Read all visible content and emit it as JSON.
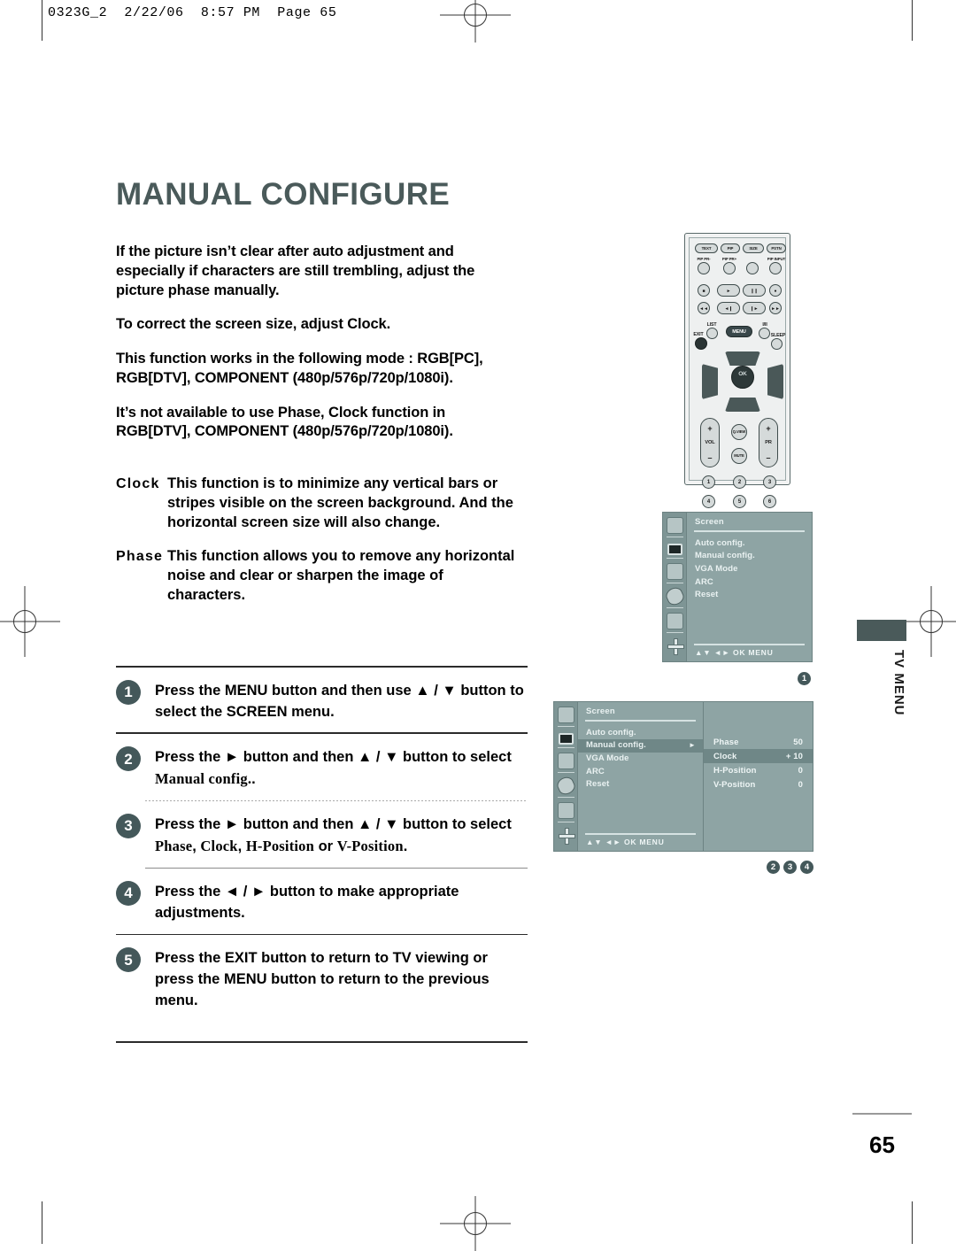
{
  "running_head": "0323G_2  2/22/06  8:57 PM  Page 65",
  "page_title": "MANUAL CONFIGURE",
  "intro_paragraphs": [
    "If the picture isn’t clear after auto adjustment and especially if characters are still trembling, adjust the picture phase manually.",
    "To correct the screen size, adjust Clock.",
    "This function works in the following mode : RGB[PC], RGB[DTV], COMPONENT (480p/576p/720p/1080i).",
    "It’s not available to use Phase, Clock function in RGB[DTV], COMPONENT (480p/576p/720p/1080i)."
  ],
  "para_2_lead": "To correct the screen size, adjust ",
  "para_2_bold": "Clock",
  "para_2_tail": ".",
  "definitions": [
    {
      "term": "Clock",
      "text": "This function is to minimize any vertical bars or stripes visible on the screen background. And the horizontal screen size will also change."
    },
    {
      "term": "Phase",
      "text": "This function allows you to remove any horizontal noise and clear or sharpen the image of characters."
    }
  ],
  "steps": [
    {
      "number": "1",
      "parts": [
        {
          "t": "Press the ",
          "s": "n"
        },
        {
          "t": "MENU",
          "s": "b"
        },
        {
          "t": " button and then use ",
          "s": "n"
        },
        {
          "t": "▲",
          "s": "n"
        },
        {
          "t": " / ",
          "s": "n"
        },
        {
          "t": "▼",
          "s": "n"
        },
        {
          "t": " button to select the ",
          "s": "n"
        },
        {
          "t": "SCREEN",
          "s": "b"
        },
        {
          "t": " menu.",
          "s": "n"
        }
      ],
      "text_plain": "Press the MENU button and then use ▲ / ▼ button to select the SCREEN menu."
    },
    {
      "number": "2",
      "text_plain": "Press the ► button and then ▲ / ▼ button to select Manual config..",
      "lead": "Press the ► button and then ▲ / ▼ button to select ",
      "lg": "Manual config.",
      "tail": "."
    },
    {
      "number": "3",
      "text_plain": "Press the ► button and then ▲ / ▼ button to select Phase, Clock, H-Position or V-Position.",
      "lead": "Press the ► button and then ▲ / ▼ button to select ",
      "lg1": "Phase",
      "sep1": ", ",
      "lg2": "Clock",
      "sep2": ", ",
      "lg3": "H-Position",
      "sep3": " or ",
      "lg4": "V-Position",
      "tail": "."
    },
    {
      "number": "4",
      "text_plain": "Press the ◄ / ► button to make appropriate adjustments."
    },
    {
      "number": "5",
      "text_plain": "Press the EXIT button to return to TV viewing or press the MENU button to return to the previous menu.",
      "lead": "Press the ",
      "b1": "EXIT",
      "mid": " button to return to TV viewing or press the ",
      "b2": "MENU",
      "tail": " button to return to the previous menu."
    }
  ],
  "remote": {
    "top_pills": [
      "TEXT",
      "PIP",
      "SIZE",
      "PSTN"
    ],
    "sub_labels": [
      "PIP PR-",
      "PIP PR+",
      "",
      "PIP INPUT"
    ],
    "media_labels": [
      "■",
      "►",
      "❙❙",
      "●",
      "◄◄",
      "◄❙",
      "❙►",
      "►►"
    ],
    "nav_labels": [
      "EXIT",
      "LIST",
      "MENU",
      "I/II",
      "SLEEP"
    ],
    "ok_label": "OK",
    "vol_label": "VOL",
    "pr_label": "PR",
    "qview_label": "Q.VIEW",
    "mute_label": "MUTE",
    "plus": "+",
    "minus": "–",
    "numbers": [
      "1",
      "2",
      "3",
      "4",
      "5",
      "6"
    ]
  },
  "osd": {
    "title": "Screen",
    "items": [
      "Auto config.",
      "Manual config.",
      "VGA Mode",
      "ARC",
      "Reset"
    ],
    "selected_item": "Manual config.",
    "arrow": "►",
    "footer": "▲▼  ◄►  OK  MENU",
    "submenu": [
      {
        "label": "Phase",
        "value": "50",
        "selected": false
      },
      {
        "label": "Clock",
        "value": "+ 10",
        "selected": true
      },
      {
        "label": "H-Position",
        "value": "0",
        "selected": false
      },
      {
        "label": "V-Position",
        "value": "0",
        "selected": false
      }
    ],
    "sidebar_icons": [
      "antenna-icon",
      "screen-icon",
      "audio-icon",
      "timer-icon",
      "special-icon",
      "setup-icon"
    ]
  },
  "callouts": {
    "one": "1",
    "two": "2",
    "three": "3",
    "four": "4"
  },
  "tv_menu_label": "TV MENU",
  "folio": "65",
  "colors": {
    "title": "#4a5a5a",
    "step_badge": "#44585a",
    "osd_bg": "#8ea4a4",
    "osd_sidebar": "#7e9595",
    "osd_selected": "#6f8787"
  }
}
